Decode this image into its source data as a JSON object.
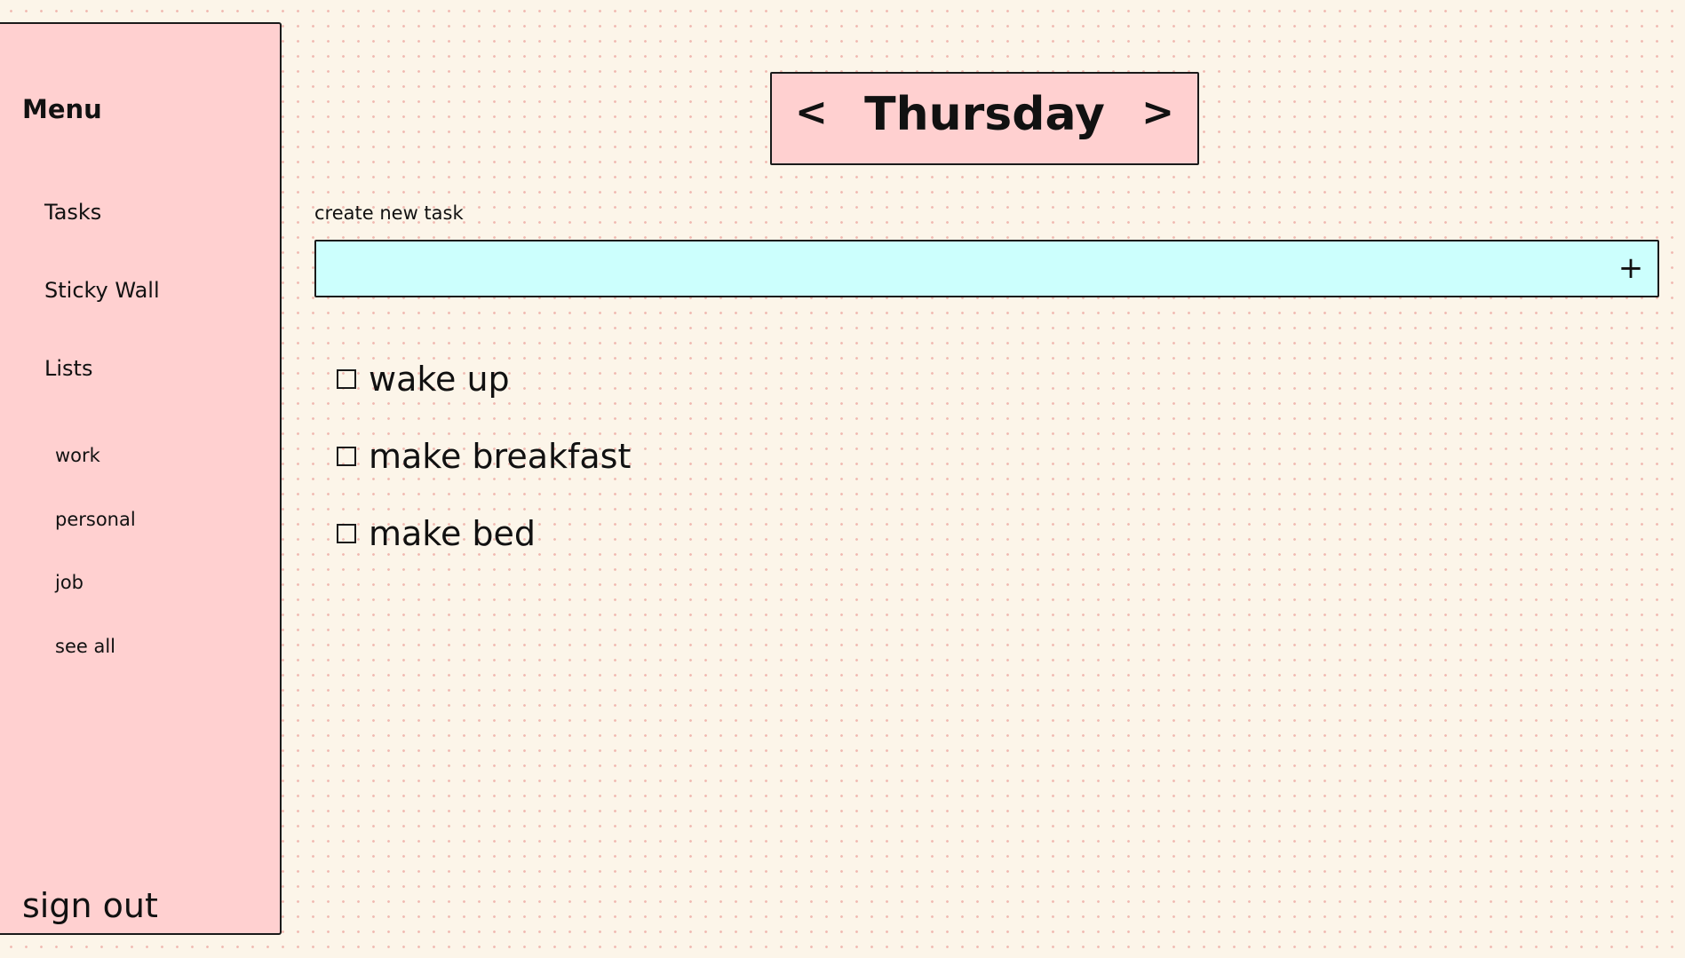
{
  "sidebar": {
    "menu_title": "Menu",
    "nav_items": [
      {
        "label": "Tasks"
      },
      {
        "label": "Sticky Wall"
      },
      {
        "label": "Lists"
      }
    ],
    "lists": [
      {
        "label": "work"
      },
      {
        "label": "personal"
      },
      {
        "label": "job"
      },
      {
        "label": "see all"
      }
    ],
    "sign_out_label": "sign out"
  },
  "day": {
    "prev_label": "<",
    "title": "Thursday",
    "next_label": ">"
  },
  "new_task": {
    "label": "create new task",
    "value": "",
    "add_label": "+"
  },
  "tasks": [
    {
      "label": "wake up",
      "checked": false
    },
    {
      "label": "make breakfast",
      "checked": false
    },
    {
      "label": "make bed",
      "checked": false
    }
  ],
  "colors": {
    "sidebar_bg": "#ffd0d0",
    "page_bg": "#fcf5e9",
    "input_bg": "#ccfffd",
    "border": "#1a1a1a"
  }
}
